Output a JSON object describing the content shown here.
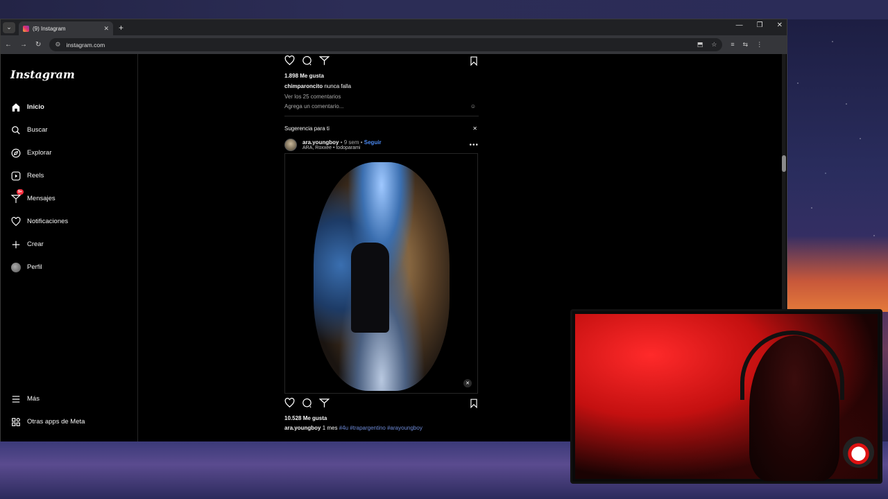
{
  "browser": {
    "tab_title": "(9) Instagram",
    "url": "instagram.com"
  },
  "sidebar": {
    "logo": "Instagram",
    "items": [
      {
        "label": "Inicio",
        "icon": "home-icon"
      },
      {
        "label": "Buscar",
        "icon": "search-icon"
      },
      {
        "label": "Explorar",
        "icon": "compass-icon"
      },
      {
        "label": "Reels",
        "icon": "reels-icon"
      },
      {
        "label": "Mensajes",
        "icon": "messenger-icon",
        "badge": "9+"
      },
      {
        "label": "Notificaciones",
        "icon": "heart-icon"
      },
      {
        "label": "Crear",
        "icon": "plus-icon"
      },
      {
        "label": "Perfil",
        "icon": "avatar"
      }
    ],
    "more": "Más",
    "meta_apps": "Otras apps de Meta"
  },
  "post1": {
    "likes": "1.898 Me gusta",
    "caption_user": "chimparoncito",
    "caption_text": "nunca falla",
    "view_comments": "Ver los 25 comentarios",
    "add_comment_placeholder": "Agrega un comentario..."
  },
  "suggestion": {
    "title": "Sugerencia para ti",
    "close": "✕"
  },
  "post2": {
    "username": "ara.youngboy",
    "age": "• 9 sem •",
    "follow": "Seguir",
    "audio": "ARA, Roxxee • todoparami",
    "likes": "10.528 Me gusta",
    "caption_user": "ara.youngboy",
    "caption_age": "1 mes",
    "caption_tags": "#4u #trapargentino #arayoungboy"
  }
}
